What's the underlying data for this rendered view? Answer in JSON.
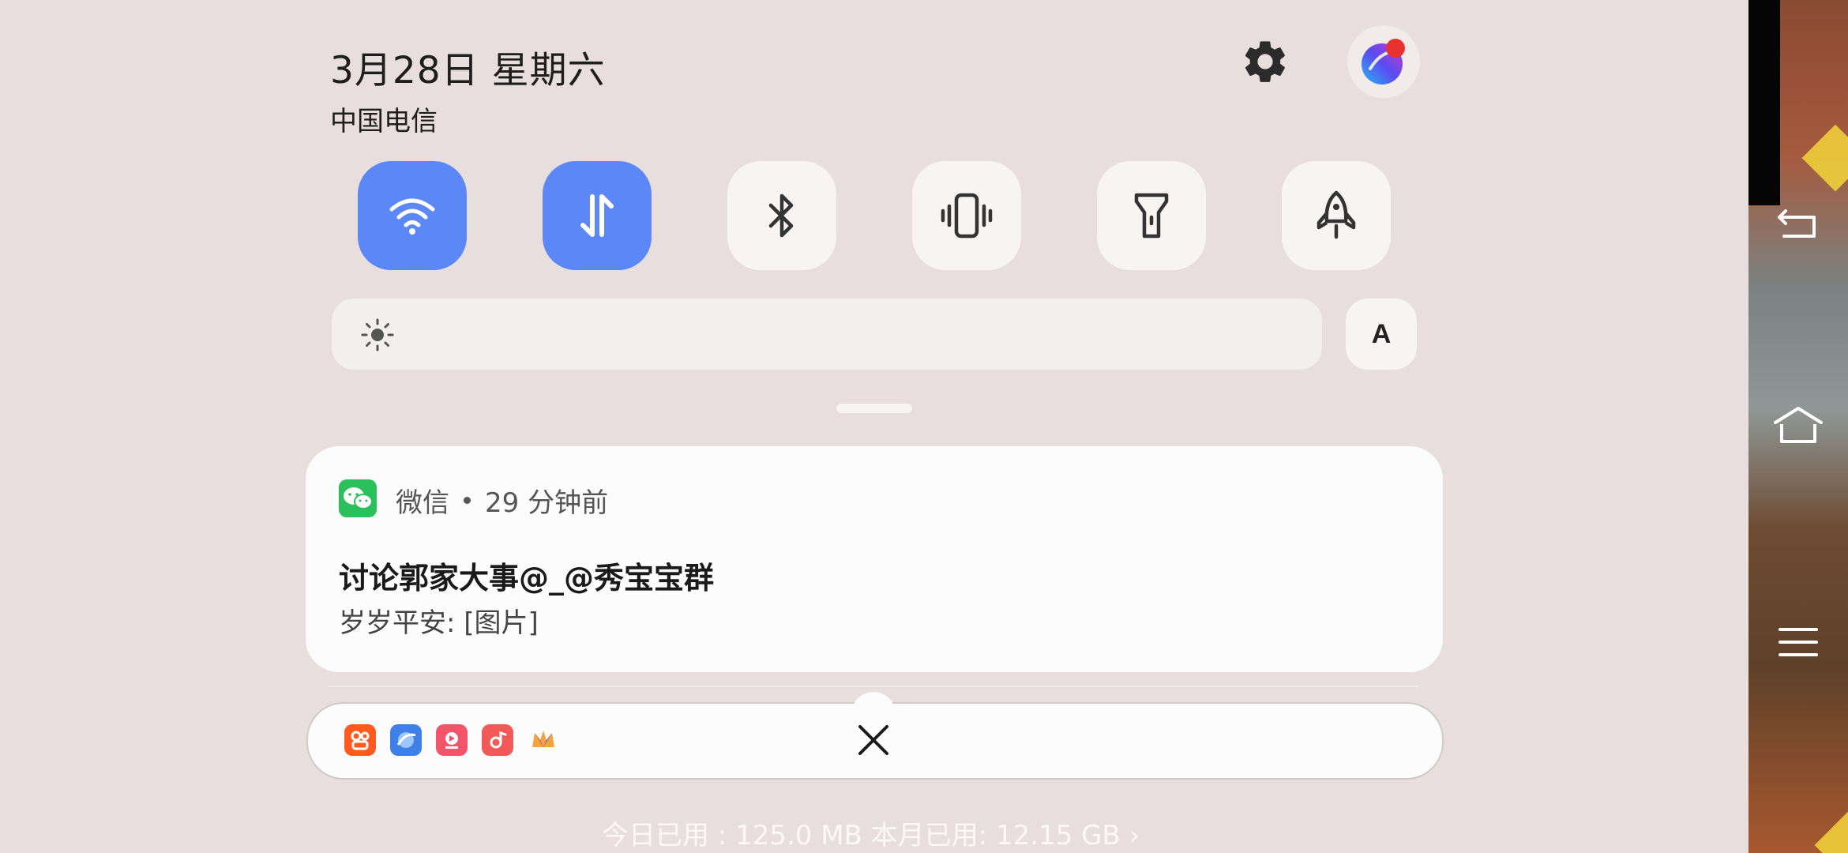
{
  "status": {
    "date": "3月28日 星期六",
    "carrier": "中国电信"
  },
  "header_buttons": {
    "settings_icon": "gear-icon",
    "assistant_icon": "assistant-orb-icon",
    "assistant_badge_color": "#e8322f"
  },
  "quick_toggles": [
    {
      "name": "wifi",
      "icon": "wifi-icon",
      "active": true
    },
    {
      "name": "mobile-data",
      "icon": "data-arrows-icon",
      "active": true
    },
    {
      "name": "bluetooth",
      "icon": "bluetooth-icon",
      "active": false
    },
    {
      "name": "vibrate",
      "icon": "vibrate-icon",
      "active": false
    },
    {
      "name": "flashlight",
      "icon": "flashlight-icon",
      "active": false
    },
    {
      "name": "boost",
      "icon": "rocket-icon",
      "active": false
    }
  ],
  "brightness": {
    "icon": "sun-icon",
    "auto_label": "A"
  },
  "notification": {
    "app_name": "微信",
    "time": "29 分钟前",
    "title": "讨论郭家大事@_@秀宝宝群",
    "body": "岁岁平安: [图片]",
    "app_icon": "wechat-icon"
  },
  "tray": {
    "app_icons": [
      {
        "name": "kuaishou-icon",
        "color": "#ff5a1f"
      },
      {
        "name": "browser-icon",
        "color": "#3f7fe8"
      },
      {
        "name": "video-app-icon",
        "color": "#f2546a"
      },
      {
        "name": "music-icon",
        "color": "#f25a5a"
      },
      {
        "name": "crown-app-icon",
        "color": "#f0a63c"
      }
    ],
    "clear_icon": "close-icon"
  },
  "usage_text": "今日已用 : 125.0 MB 本月已用: 12.15 GB ›",
  "colors": {
    "toggle_active": "#5b87f7",
    "shade_bg": "#e8dedd",
    "card_bg": "#fdfcfc"
  }
}
